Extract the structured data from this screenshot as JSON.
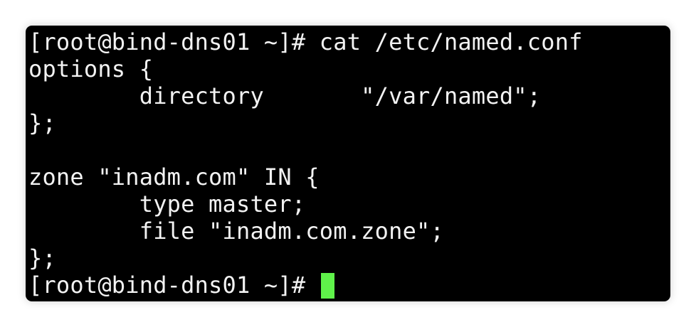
{
  "terminal": {
    "lines": [
      "[root@bind-dns01 ~]# cat /etc/named.conf",
      "options {",
      "        directory       \"/var/named\";",
      "};",
      "",
      "zone \"inadm.com\" IN {",
      "        type master;",
      "        file \"inadm.com.zone\";",
      "};"
    ],
    "prompt": "[root@bind-dns01 ~]# ",
    "cursor_color": "#5ff24a"
  }
}
